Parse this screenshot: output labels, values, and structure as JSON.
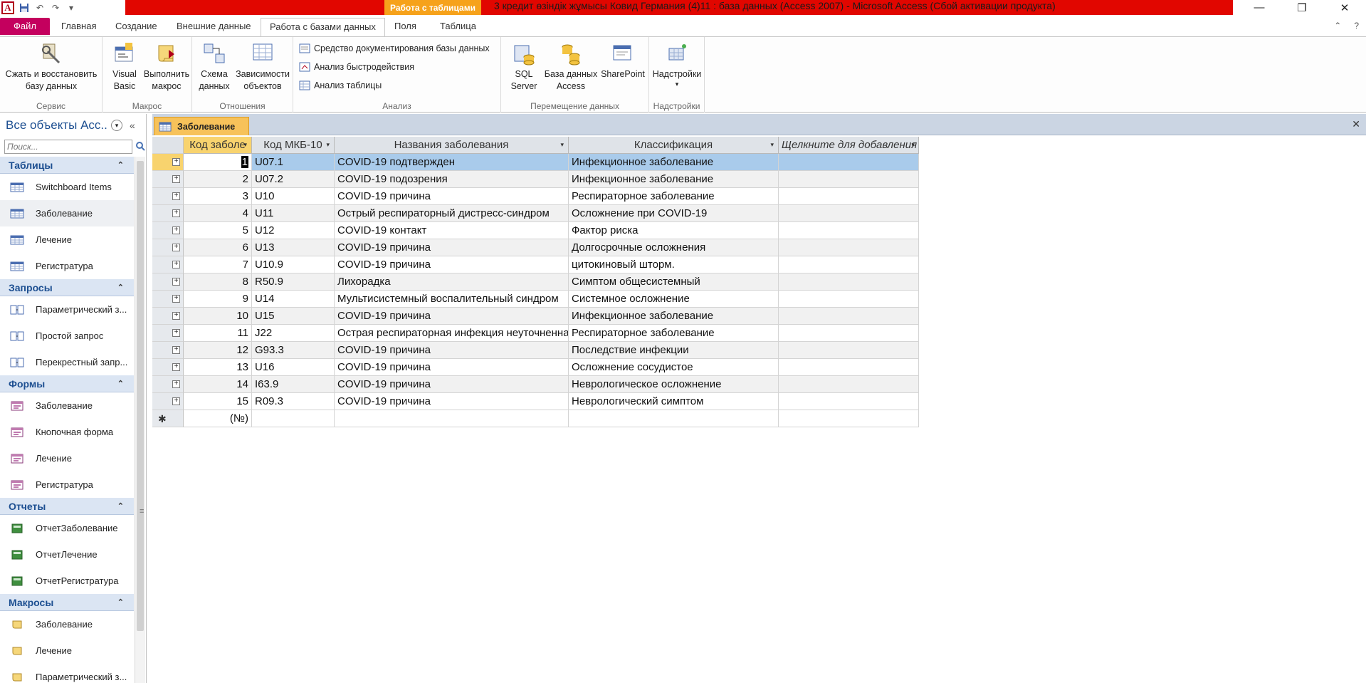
{
  "titlebar": {
    "app_logo": "A",
    "context_header": "Работа с таблицами",
    "title": "3 кредит өзіндік жұмысы Ковид Германия (4)11 : база данных (Access 2007)  -  Microsoft Access (Сбой активации продукта)",
    "min": "—",
    "restore": "❐",
    "close": "✕"
  },
  "ribbon_tabs": {
    "file": "Файл",
    "home": "Главная",
    "create": "Создание",
    "external": "Внешние данные",
    "database_tools": "Работа с базами данных",
    "fields": "Поля",
    "table": "Таблица"
  },
  "ribbon": {
    "groups": {
      "service": "Сервис",
      "macro": "Макрос",
      "relations": "Отношения",
      "analysis": "Анализ",
      "move_data": "Перемещение данных",
      "addins": "Надстройки"
    },
    "compact_line1": "Сжать и восстановить",
    "compact_line2": "базу данных",
    "vb_line1": "Visual",
    "vb_line2": "Basic",
    "run_macro_line1": "Выполнить",
    "run_macro_line2": "макрос",
    "schema_line1": "Схема",
    "schema_line2": "данных",
    "deps_line1": "Зависимости",
    "deps_line2": "объектов",
    "documenter": "Средство документирования базы данных",
    "perf": "Анализ быстродействия",
    "table_analyze": "Анализ таблицы",
    "sql_line1": "SQL",
    "sql_line2": "Server",
    "access_db_line1": "База данных",
    "access_db_line2": "Access",
    "sharepoint": "SharePoint",
    "addins_btn": "Надстройки"
  },
  "nav": {
    "title": "Все объекты Acc...",
    "search_placeholder": "Поиск...",
    "sections": [
      {
        "label": "Таблицы",
        "items": [
          "Switchboard Items",
          "Заболевание",
          "Лечение",
          "Регистратура"
        ]
      },
      {
        "label": "Запросы",
        "items": [
          "Параметрический з...",
          "Простой запрос",
          "Перекрестный запр..."
        ]
      },
      {
        "label": "Формы",
        "items": [
          "Заболевание",
          "Кнопочная форма",
          "Лечение",
          "Регистратура"
        ]
      },
      {
        "label": "Отчеты",
        "items": [
          "ОтчетЗаболевание",
          "ОтчетЛечение",
          "ОтчетРегистратура"
        ]
      },
      {
        "label": "Макросы",
        "items": [
          "Заболевание",
          "Лечение",
          "Параметрический з..."
        ]
      }
    ]
  },
  "document": {
    "tab_label": "Заболевание",
    "close": "✕"
  },
  "table": {
    "columns": [
      "Код заболе",
      "Код МКБ-10",
      "Названия заболевания",
      "Классификация",
      "Щелкните для добавления"
    ],
    "rows": [
      [
        "1",
        "U07.1",
        "COVID-19 подтвержден",
        "Инфекционное заболевание"
      ],
      [
        "2",
        "U07.2",
        "COVID-19 подозрения",
        "Инфекционное заболевание"
      ],
      [
        "3",
        "U10",
        "COVID-19 причина",
        "Респираторное заболевание"
      ],
      [
        "4",
        "U11",
        "Острый респираторный дистресс-синдром",
        "Осложнение при COVID-19"
      ],
      [
        "5",
        "U12",
        "COVID-19 контакт",
        "Фактор риска"
      ],
      [
        "6",
        "U13",
        "COVID-19 причина",
        "Долгосрочные осложнения"
      ],
      [
        "7",
        "U10.9",
        "COVID-19 причина",
        "цитокиновый шторм."
      ],
      [
        "8",
        "R50.9",
        "Лихорадка",
        "Симптом общесистемный"
      ],
      [
        "9",
        "U14",
        "Мультисистемный воспалительный синдром",
        "Системное осложнение"
      ],
      [
        "10",
        "U15",
        "COVID-19 причина",
        "Инфекционное заболевание"
      ],
      [
        "11",
        "J22",
        "Острая респираторная инфекция неуточненная",
        "Респираторное заболевание"
      ],
      [
        "12",
        "G93.3",
        "COVID-19 причина",
        "Последствие инфекции"
      ],
      [
        "13",
        "U16",
        "COVID-19 причина",
        "Осложнение сосудистое"
      ],
      [
        "14",
        "I63.9",
        "COVID-19 причина",
        "Неврологическое осложнение"
      ],
      [
        "15",
        "R09.3",
        "COVID-19 причина",
        "Неврологический симптом"
      ]
    ],
    "new_row_label": "(№)",
    "new_row_marker": "✱",
    "expander": "+"
  }
}
